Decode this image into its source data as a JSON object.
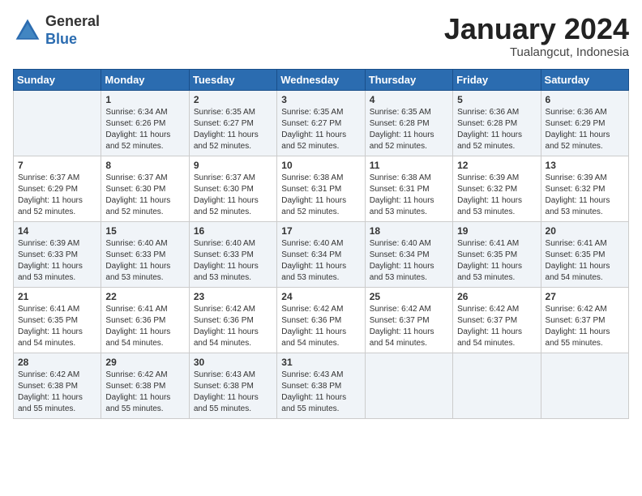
{
  "header": {
    "logo_general": "General",
    "logo_blue": "Blue",
    "month_year": "January 2024",
    "location": "Tualangcut, Indonesia"
  },
  "weekdays": [
    "Sunday",
    "Monday",
    "Tuesday",
    "Wednesday",
    "Thursday",
    "Friday",
    "Saturday"
  ],
  "weeks": [
    [
      {
        "day": "",
        "sunrise": "",
        "sunset": "",
        "daylight": ""
      },
      {
        "day": "1",
        "sunrise": "Sunrise: 6:34 AM",
        "sunset": "Sunset: 6:26 PM",
        "daylight": "Daylight: 11 hours and 52 minutes."
      },
      {
        "day": "2",
        "sunrise": "Sunrise: 6:35 AM",
        "sunset": "Sunset: 6:27 PM",
        "daylight": "Daylight: 11 hours and 52 minutes."
      },
      {
        "day": "3",
        "sunrise": "Sunrise: 6:35 AM",
        "sunset": "Sunset: 6:27 PM",
        "daylight": "Daylight: 11 hours and 52 minutes."
      },
      {
        "day": "4",
        "sunrise": "Sunrise: 6:35 AM",
        "sunset": "Sunset: 6:28 PM",
        "daylight": "Daylight: 11 hours and 52 minutes."
      },
      {
        "day": "5",
        "sunrise": "Sunrise: 6:36 AM",
        "sunset": "Sunset: 6:28 PM",
        "daylight": "Daylight: 11 hours and 52 minutes."
      },
      {
        "day": "6",
        "sunrise": "Sunrise: 6:36 AM",
        "sunset": "Sunset: 6:29 PM",
        "daylight": "Daylight: 11 hours and 52 minutes."
      }
    ],
    [
      {
        "day": "7",
        "sunrise": "Sunrise: 6:37 AM",
        "sunset": "Sunset: 6:29 PM",
        "daylight": "Daylight: 11 hours and 52 minutes."
      },
      {
        "day": "8",
        "sunrise": "Sunrise: 6:37 AM",
        "sunset": "Sunset: 6:30 PM",
        "daylight": "Daylight: 11 hours and 52 minutes."
      },
      {
        "day": "9",
        "sunrise": "Sunrise: 6:37 AM",
        "sunset": "Sunset: 6:30 PM",
        "daylight": "Daylight: 11 hours and 52 minutes."
      },
      {
        "day": "10",
        "sunrise": "Sunrise: 6:38 AM",
        "sunset": "Sunset: 6:31 PM",
        "daylight": "Daylight: 11 hours and 52 minutes."
      },
      {
        "day": "11",
        "sunrise": "Sunrise: 6:38 AM",
        "sunset": "Sunset: 6:31 PM",
        "daylight": "Daylight: 11 hours and 53 minutes."
      },
      {
        "day": "12",
        "sunrise": "Sunrise: 6:39 AM",
        "sunset": "Sunset: 6:32 PM",
        "daylight": "Daylight: 11 hours and 53 minutes."
      },
      {
        "day": "13",
        "sunrise": "Sunrise: 6:39 AM",
        "sunset": "Sunset: 6:32 PM",
        "daylight": "Daylight: 11 hours and 53 minutes."
      }
    ],
    [
      {
        "day": "14",
        "sunrise": "Sunrise: 6:39 AM",
        "sunset": "Sunset: 6:33 PM",
        "daylight": "Daylight: 11 hours and 53 minutes."
      },
      {
        "day": "15",
        "sunrise": "Sunrise: 6:40 AM",
        "sunset": "Sunset: 6:33 PM",
        "daylight": "Daylight: 11 hours and 53 minutes."
      },
      {
        "day": "16",
        "sunrise": "Sunrise: 6:40 AM",
        "sunset": "Sunset: 6:33 PM",
        "daylight": "Daylight: 11 hours and 53 minutes."
      },
      {
        "day": "17",
        "sunrise": "Sunrise: 6:40 AM",
        "sunset": "Sunset: 6:34 PM",
        "daylight": "Daylight: 11 hours and 53 minutes."
      },
      {
        "day": "18",
        "sunrise": "Sunrise: 6:40 AM",
        "sunset": "Sunset: 6:34 PM",
        "daylight": "Daylight: 11 hours and 53 minutes."
      },
      {
        "day": "19",
        "sunrise": "Sunrise: 6:41 AM",
        "sunset": "Sunset: 6:35 PM",
        "daylight": "Daylight: 11 hours and 53 minutes."
      },
      {
        "day": "20",
        "sunrise": "Sunrise: 6:41 AM",
        "sunset": "Sunset: 6:35 PM",
        "daylight": "Daylight: 11 hours and 54 minutes."
      }
    ],
    [
      {
        "day": "21",
        "sunrise": "Sunrise: 6:41 AM",
        "sunset": "Sunset: 6:35 PM",
        "daylight": "Daylight: 11 hours and 54 minutes."
      },
      {
        "day": "22",
        "sunrise": "Sunrise: 6:41 AM",
        "sunset": "Sunset: 6:36 PM",
        "daylight": "Daylight: 11 hours and 54 minutes."
      },
      {
        "day": "23",
        "sunrise": "Sunrise: 6:42 AM",
        "sunset": "Sunset: 6:36 PM",
        "daylight": "Daylight: 11 hours and 54 minutes."
      },
      {
        "day": "24",
        "sunrise": "Sunrise: 6:42 AM",
        "sunset": "Sunset: 6:36 PM",
        "daylight": "Daylight: 11 hours and 54 minutes."
      },
      {
        "day": "25",
        "sunrise": "Sunrise: 6:42 AM",
        "sunset": "Sunset: 6:37 PM",
        "daylight": "Daylight: 11 hours and 54 minutes."
      },
      {
        "day": "26",
        "sunrise": "Sunrise: 6:42 AM",
        "sunset": "Sunset: 6:37 PM",
        "daylight": "Daylight: 11 hours and 54 minutes."
      },
      {
        "day": "27",
        "sunrise": "Sunrise: 6:42 AM",
        "sunset": "Sunset: 6:37 PM",
        "daylight": "Daylight: 11 hours and 55 minutes."
      }
    ],
    [
      {
        "day": "28",
        "sunrise": "Sunrise: 6:42 AM",
        "sunset": "Sunset: 6:38 PM",
        "daylight": "Daylight: 11 hours and 55 minutes."
      },
      {
        "day": "29",
        "sunrise": "Sunrise: 6:42 AM",
        "sunset": "Sunset: 6:38 PM",
        "daylight": "Daylight: 11 hours and 55 minutes."
      },
      {
        "day": "30",
        "sunrise": "Sunrise: 6:43 AM",
        "sunset": "Sunset: 6:38 PM",
        "daylight": "Daylight: 11 hours and 55 minutes."
      },
      {
        "day": "31",
        "sunrise": "Sunrise: 6:43 AM",
        "sunset": "Sunset: 6:38 PM",
        "daylight": "Daylight: 11 hours and 55 minutes."
      },
      {
        "day": "",
        "sunrise": "",
        "sunset": "",
        "daylight": ""
      },
      {
        "day": "",
        "sunrise": "",
        "sunset": "",
        "daylight": ""
      },
      {
        "day": "",
        "sunrise": "",
        "sunset": "",
        "daylight": ""
      }
    ]
  ]
}
